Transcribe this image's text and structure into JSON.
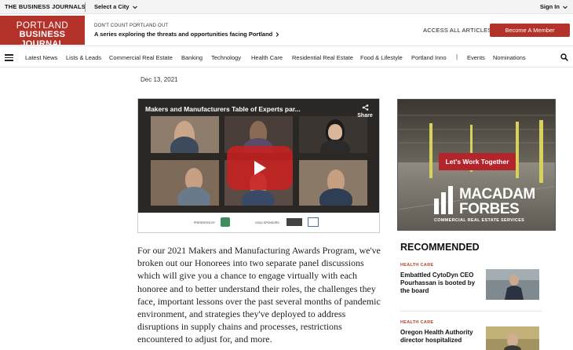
{
  "topbar": {
    "brand": "THE BUSINESS JOURNALS",
    "city_select": "Select a City",
    "sign_in": "Sign In"
  },
  "header": {
    "logo_line1": "PORTLAND",
    "logo_line2": "BUSINESS JOURNAL",
    "promo_kicker": "DON'T COUNT PORTLAND OUT",
    "promo_text": "A series exploring the threats and opportunities facing Portland",
    "access_all": "ACCESS ALL ARTICLES",
    "member_button": "Become A Member"
  },
  "nav": {
    "items": [
      "Latest News",
      "Lists & Leads",
      "Commercial Real Estate",
      "Banking",
      "Technology",
      "Health Care",
      "Residential Real Estate",
      "Food & Lifestyle",
      "Portland Inno",
      "Events",
      "Nominations"
    ],
    "separator": "|"
  },
  "article": {
    "date": "Dec 13, 2021",
    "video_title": "Makers and Manufacturers Table of Experts par...",
    "share_label": "Share",
    "video_footer": {
      "presented_by": "PRESENTED BY",
      "sole_sponsors": "GOLD SPONSORS"
    },
    "body": "For our 2021 Makers and Manufacturing Awards Program, we've broken out our Honorees into two separate panel discussions which will give you a chance to engage virtually with each honoree and to better understand their roles, the challenges they face, important lessons over the past several months of pandemic environment, and strategies they've deployed to address disruptions in supply chains and processes, restrictions encountered to adjust for, and more."
  },
  "ad": {
    "cta": "Let's Work Together",
    "logo_word1": "MACADAM",
    "logo_word2": "FORBES",
    "tagline": "COMMERCIAL REAL ESTATE SERVICES"
  },
  "recommended": {
    "heading": "RECOMMENDED",
    "items": [
      {
        "category": "HEALTH CARE",
        "title": "Embattled CytoDyn CEO Pourhassan is booted by the board"
      },
      {
        "category": "HEALTH CARE",
        "title": "Oregon Health Authority director hospitalized"
      }
    ]
  },
  "colors": {
    "brand_red": "#b3322a",
    "category_red": "#b1432b",
    "play_red": "#cd201f"
  }
}
